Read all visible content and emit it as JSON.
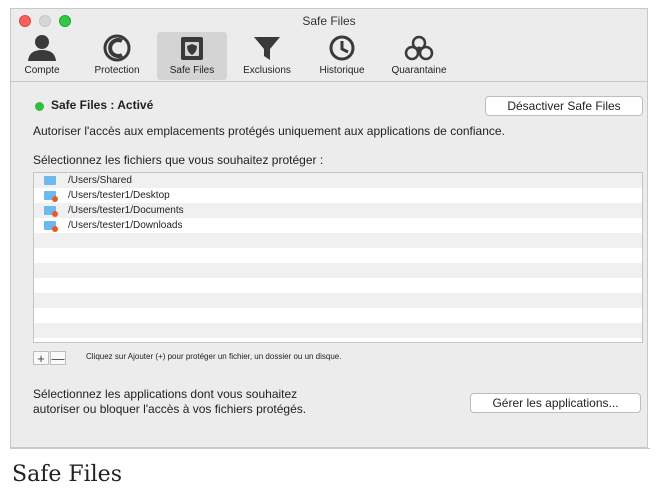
{
  "window": {
    "title": "Safe Files"
  },
  "toolbar": {
    "items": [
      {
        "label": "Compte",
        "icon": "person-icon"
      },
      {
        "label": "Protection",
        "icon": "shield-ring-icon"
      },
      {
        "label": "Safe Files",
        "icon": "safe-shield-icon",
        "active": true
      },
      {
        "label": "Exclusions",
        "icon": "filter-icon"
      },
      {
        "label": "Historique",
        "icon": "clock-icon"
      },
      {
        "label": "Quarantaine",
        "icon": "biohazard-icon"
      }
    ]
  },
  "status": {
    "text": "Safe Files : Activé",
    "color": "#2fbf3c"
  },
  "buttons": {
    "deactivate": "Désactiver Safe Files",
    "manage_apps": "Gérer les applications..."
  },
  "descriptions": {
    "access": "Autoriser l'accès aux emplacements protégés uniquement aux applications de confiance.",
    "select_files": "Sélectionnez les fichiers que vous souhaitez protéger :",
    "hint": "Cliquez sur Ajouter (+) pour protéger un fichier, un dossier ou un disque.",
    "apps": "Sélectionnez les applications dont vous souhaitez autoriser ou bloquer l'accès à vos fichiers protégés."
  },
  "list": {
    "paths": [
      "/Users/Shared",
      "/Users/tester1/Desktop",
      "/Users/tester1/Documents",
      "/Users/tester1/Downloads"
    ]
  },
  "controls": {
    "add": "+",
    "remove": "—"
  },
  "caption": "Safe Files"
}
